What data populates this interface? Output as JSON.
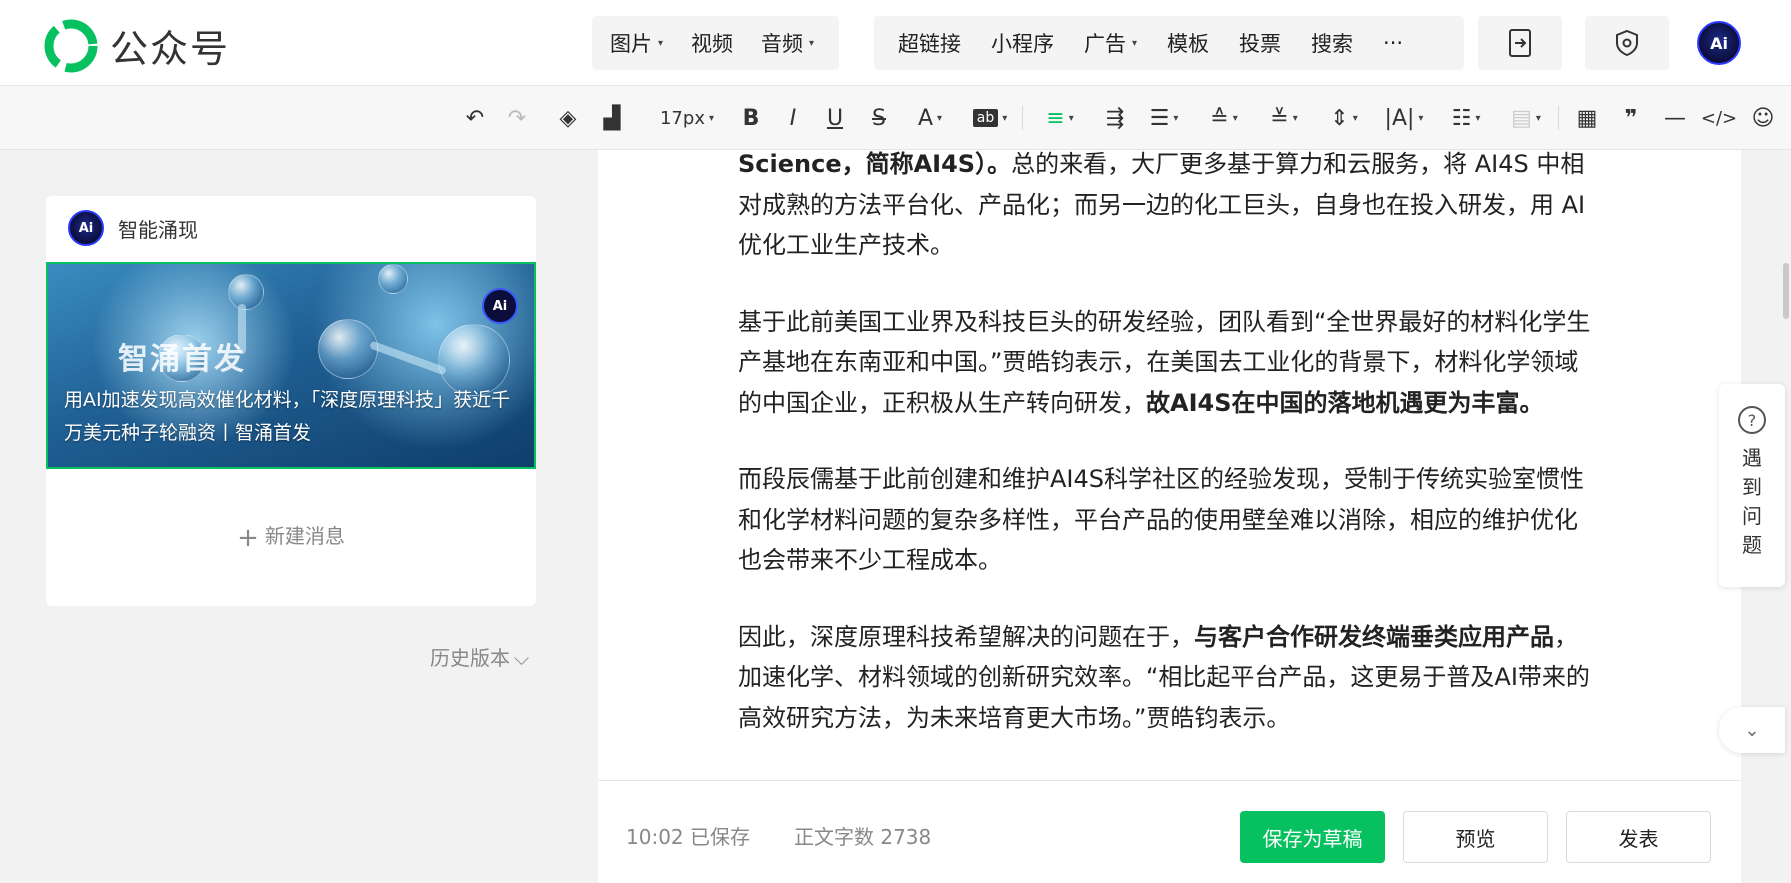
{
  "header": {
    "app_title": "公众号",
    "media_menu": [
      {
        "label": "图片",
        "has_dropdown": true
      },
      {
        "label": "视频",
        "has_dropdown": false
      },
      {
        "label": "音频",
        "has_dropdown": true
      }
    ],
    "insert_menu": [
      {
        "label": "超链接",
        "has_dropdown": false
      },
      {
        "label": "小程序",
        "has_dropdown": false
      },
      {
        "label": "广告",
        "has_dropdown": true
      },
      {
        "label": "模板",
        "has_dropdown": false
      },
      {
        "label": "投票",
        "has_dropdown": false
      },
      {
        "label": "搜索",
        "has_dropdown": false
      }
    ],
    "more_label": "···",
    "avatar_label": "Ai",
    "brand_color": "#07c160"
  },
  "toolbar": {
    "font_size": "17px"
  },
  "left_panel": {
    "account_name": "智能涌现",
    "account_avatar_label": "Ai",
    "cover_brand": "智涌首发",
    "cover_badge": "Ai",
    "cover_title": "用AI加速发现高效催化材料，「深度原理科技」获近千万美元种子轮融资丨智涌首发",
    "new_message": "新建消息",
    "history": "历史版本"
  },
  "editor": {
    "p1_bold": "Science，简称AI4S）。",
    "p1_text": "总的来看，大厂更多基于算力和云服务，将 AI4S 中相对成熟的方法平台化、产品化；而另一边的化工巨头，自身也在投入研发，用 AI 优化工业生产技术。",
    "p2_text": "基于此前美国工业界及科技巨头的研发经验，团队看到“全世界最好的材料化学生产基地在东南亚和中国。”贾皓钧表示，在美国去工业化的背景下，材料化学领域的中国企业，正积极从生产转向研发，",
    "p2_bold": "故AI4S在中国的落地机遇更为丰富。",
    "p3_text": "而段辰儒基于此前创建和维护AI4S科学社区的经验发现，受制于传统实验室惯性和化学材料问题的复杂多样性，平台产品的使用壁垒难以消除，相应的维护优化也会带来不少工程成本。",
    "p4_text": "因此，深度原理科技希望解决的问题在于，",
    "p4_bold": "与客户合作研发终端垂类应用产品",
    "p4_tail": "，加速化学、材料领域的创新研究效率。“相比起平台产品，这更易于普及AI带来的高效研究方法，为未来培育更大市场。”贾皓钧表示。"
  },
  "footer": {
    "saved_time": "10:02",
    "saved_label": "已保存",
    "wordcount_label": "正文字数",
    "wordcount_value": "2738",
    "save_draft": "保存为草稿",
    "preview": "预览",
    "publish": "发表"
  },
  "help_widget": {
    "label": "遇到问题"
  }
}
